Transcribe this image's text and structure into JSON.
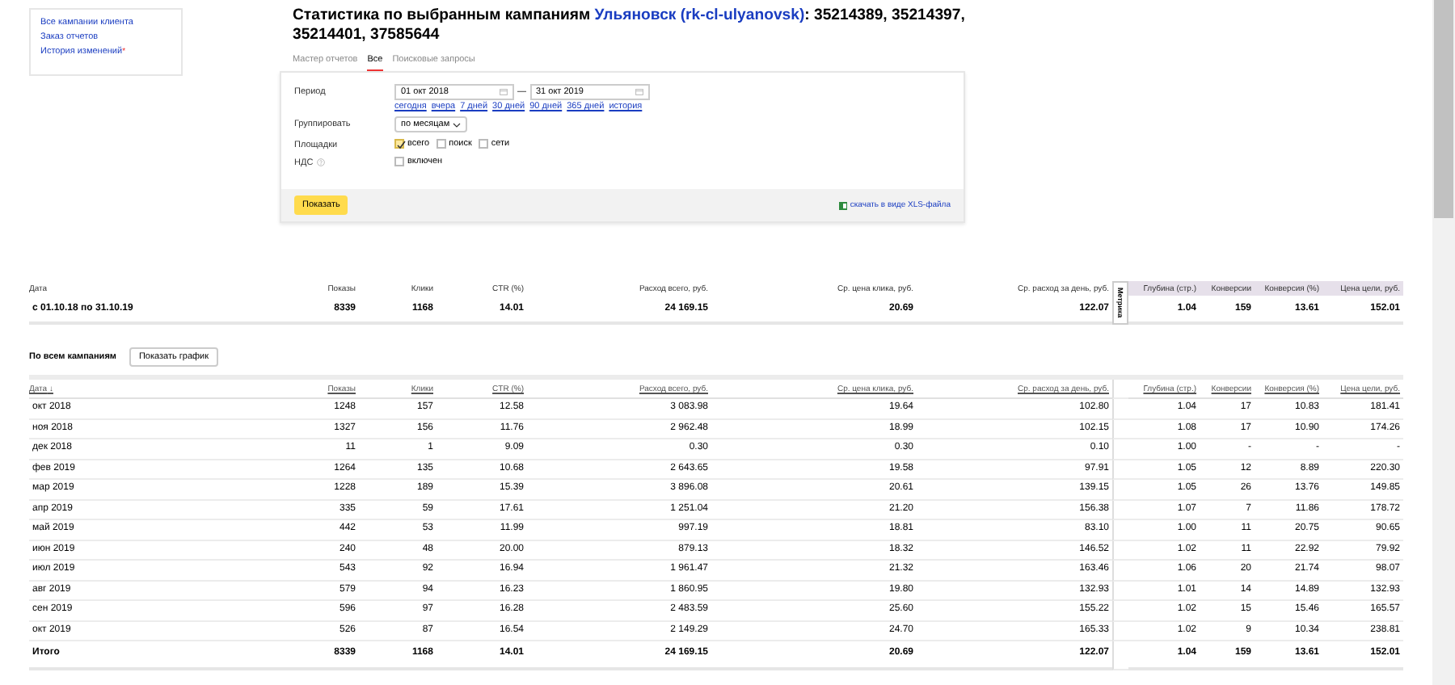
{
  "sidebar": {
    "links": [
      {
        "label": "Все кампании клиента"
      },
      {
        "label": "Заказ отчетов"
      },
      {
        "label": "История изменений",
        "badge": "*"
      }
    ]
  },
  "title": {
    "text": "Статистика по выбранным кампаниям",
    "client": "Ульяновск (rk-cl-ulyanovsk)",
    "ids": ": 35214389, 35214397, 35214401, 37585644"
  },
  "tabs": [
    {
      "label": "Мастер отчетов",
      "selected": false
    },
    {
      "label": "Все",
      "selected": true
    },
    {
      "label": "Поисковые запросы",
      "selected": false
    }
  ],
  "form": {
    "period": {
      "label": "Период",
      "from": "01 окт 2018",
      "separator": "—",
      "to": "31 окт 2019",
      "quick_links": [
        "сегодня",
        "вчера",
        "7 дней",
        "30 дней",
        "90 дней",
        "365 дней",
        "история"
      ]
    },
    "group": {
      "label": "Группировать",
      "value": "по месяцам"
    },
    "sites": {
      "label": "Площадки",
      "options": [
        {
          "label": "всего",
          "checked": true
        },
        {
          "label": "поиск",
          "checked": false
        },
        {
          "label": "сети",
          "checked": false
        }
      ]
    },
    "vat": {
      "label": "НДС",
      "option": {
        "label": "включен",
        "checked": false
      }
    },
    "show_button": "Показать",
    "xls_link": "скачать в виде XLS-файла"
  },
  "summary": {
    "columns": [
      {
        "label": "Дата",
        "kind": "direct"
      },
      {
        "label": "Показы",
        "kind": "direct"
      },
      {
        "label": "Клики",
        "kind": "direct"
      },
      {
        "label": "CTR (%)",
        "kind": "direct"
      },
      {
        "label": "Расход всего, руб.",
        "kind": "direct"
      },
      {
        "label": "Ср. цена клика, руб.",
        "kind": "direct"
      },
      {
        "label": "Ср. расход за день, руб.",
        "kind": "direct"
      },
      {
        "label": "Глубина (стр.)",
        "kind": "metrika"
      },
      {
        "label": "Конверсии",
        "kind": "metrika"
      },
      {
        "label": "Конверсия (%)",
        "kind": "metrika"
      },
      {
        "label": "Цена цели, руб.",
        "kind": "metrika"
      }
    ],
    "metrika_tab": "Метрика",
    "row": [
      "с 01.10.18 по 31.10.19",
      "8339",
      "1168",
      "14.01",
      "24 169.15",
      "20.69",
      "122.07",
      "1.04",
      "159",
      "13.61",
      "152.01"
    ]
  },
  "section": {
    "title": "По всем кампаниям",
    "chart_button": "Показать график"
  },
  "table": {
    "columns": [
      {
        "label": "Дата",
        "sort_mark": "↓",
        "kind": "direct"
      },
      {
        "label": "Показы",
        "kind": "direct"
      },
      {
        "label": "Клики",
        "kind": "direct"
      },
      {
        "label": "CTR (%)",
        "kind": "direct"
      },
      {
        "label": "Расход всего, руб.",
        "kind": "direct"
      },
      {
        "label": "Ср. цена клика, руб.",
        "kind": "direct"
      },
      {
        "label": "Ср. расход за день, руб.",
        "kind": "direct"
      },
      {
        "label": "Глубина (стр.)",
        "kind": "metrika"
      },
      {
        "label": "Конверсии",
        "kind": "metrika"
      },
      {
        "label": "Конверсия (%)",
        "kind": "metrika"
      },
      {
        "label": "Цена цели, руб.",
        "kind": "metrika"
      }
    ],
    "rows": [
      [
        "окт 2018",
        "1248",
        "157",
        "12.58",
        "3 083.98",
        "19.64",
        "102.80",
        "1.04",
        "17",
        "10.83",
        "181.41"
      ],
      [
        "ноя 2018",
        "1327",
        "156",
        "11.76",
        "2 962.48",
        "18.99",
        "102.15",
        "1.08",
        "17",
        "10.90",
        "174.26"
      ],
      [
        "дек 2018",
        "11",
        "1",
        "9.09",
        "0.30",
        "0.30",
        "0.10",
        "1.00",
        "-",
        "-",
        "-"
      ],
      [
        "фев 2019",
        "1264",
        "135",
        "10.68",
        "2 643.65",
        "19.58",
        "97.91",
        "1.05",
        "12",
        "8.89",
        "220.30"
      ],
      [
        "мар 2019",
        "1228",
        "189",
        "15.39",
        "3 896.08",
        "20.61",
        "139.15",
        "1.05",
        "26",
        "13.76",
        "149.85"
      ],
      [
        "апр 2019",
        "335",
        "59",
        "17.61",
        "1 251.04",
        "21.20",
        "156.38",
        "1.07",
        "7",
        "11.86",
        "178.72"
      ],
      [
        "май 2019",
        "442",
        "53",
        "11.99",
        "997.19",
        "18.81",
        "83.10",
        "1.00",
        "11",
        "20.75",
        "90.65"
      ],
      [
        "июн 2019",
        "240",
        "48",
        "20.00",
        "879.13",
        "18.32",
        "146.52",
        "1.02",
        "11",
        "22.92",
        "79.92"
      ],
      [
        "июл 2019",
        "543",
        "92",
        "16.94",
        "1 961.47",
        "21.32",
        "163.46",
        "1.06",
        "20",
        "21.74",
        "98.07"
      ],
      [
        "авг 2019",
        "579",
        "94",
        "16.23",
        "1 860.95",
        "19.80",
        "132.93",
        "1.01",
        "14",
        "14.89",
        "132.93"
      ],
      [
        "сен 2019",
        "596",
        "97",
        "16.28",
        "2 483.59",
        "25.60",
        "155.22",
        "1.02",
        "15",
        "15.46",
        "165.57"
      ],
      [
        "окт 2019",
        "526",
        "87",
        "16.54",
        "2 149.29",
        "24.70",
        "165.33",
        "1.02",
        "9",
        "10.34",
        "238.81"
      ]
    ],
    "total": [
      "Итого",
      "8339",
      "1168",
      "14.01",
      "24 169.15",
      "20.69",
      "122.07",
      "1.04",
      "159",
      "13.61",
      "152.01"
    ]
  }
}
